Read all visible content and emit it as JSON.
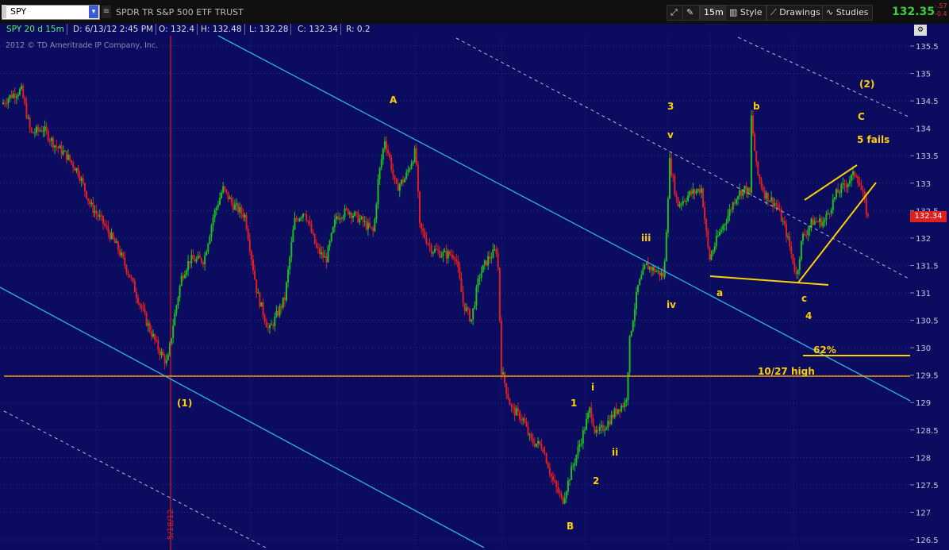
{
  "toolbar": {
    "symbol": "SPY",
    "description": "SPDR TR S&P 500 ETF TRUST",
    "interval": "15m",
    "style_label": "Style",
    "drawings_label": "Drawings",
    "studies_label": "Studies",
    "last_price": "132.35",
    "change_line1": "-.57",
    "change_line2": "-0.4"
  },
  "info_bar": {
    "ticker": "SPY 20 d 15m",
    "date": "D: 6/13/12 2:45 PM",
    "open": "O: 132.4",
    "high": "H: 132.48",
    "low": "L: 132.28",
    "close": "C: 132.34",
    "range": "R: 0.2"
  },
  "copyright": "2012 © TD Ameritrade IP Company, Inc.",
  "price_tag": "132.34",
  "vline_date": "5/18/12",
  "colors": {
    "background": "#0b0b5f",
    "up": "#1fbf1f",
    "down": "#e02020",
    "trend": "#2fb4e6",
    "annotation": "#ffd000"
  },
  "chart_data": {
    "type": "candlestick",
    "y_ticks": [
      135.5,
      135,
      134.5,
      134,
      133.5,
      133,
      132.5,
      132,
      131.5,
      131,
      130.5,
      130,
      129.5,
      129,
      128.5,
      128,
      127.5,
      127,
      126.5
    ],
    "ylim": [
      126.5,
      135.5
    ],
    "bars_count": 520,
    "price_path": [
      [
        0,
        134.4
      ],
      [
        15,
        134.6
      ],
      [
        28,
        134.7
      ],
      [
        40,
        133.9
      ],
      [
        55,
        134.0
      ],
      [
        70,
        133.7
      ],
      [
        85,
        133.5
      ],
      [
        100,
        133.2
      ],
      [
        115,
        132.6
      ],
      [
        130,
        132.3
      ],
      [
        150,
        131.8
      ],
      [
        165,
        131.3
      ],
      [
        185,
        130.5
      ],
      [
        200,
        130.0
      ],
      [
        212,
        129.7
      ],
      [
        220,
        130.5
      ],
      [
        230,
        131.3
      ],
      [
        240,
        131.6
      ],
      [
        258,
        131.6
      ],
      [
        270,
        132.4
      ],
      [
        282,
        132.9
      ],
      [
        295,
        132.6
      ],
      [
        310,
        132.4
      ],
      [
        325,
        131.0
      ],
      [
        340,
        130.3
      ],
      [
        360,
        130.9
      ],
      [
        372,
        132.3
      ],
      [
        385,
        132.5
      ],
      [
        400,
        131.8
      ],
      [
        412,
        131.6
      ],
      [
        425,
        132.4
      ],
      [
        440,
        132.5
      ],
      [
        458,
        132.3
      ],
      [
        472,
        132.1
      ],
      [
        478,
        133.1
      ],
      [
        486,
        133.8
      ],
      [
        493,
        133.4
      ],
      [
        500,
        132.9
      ],
      [
        512,
        133.1
      ],
      [
        525,
        133.6
      ],
      [
        530,
        132.2
      ],
      [
        545,
        131.8
      ],
      [
        560,
        131.7
      ],
      [
        575,
        131.7
      ],
      [
        585,
        130.8
      ],
      [
        595,
        130.5
      ],
      [
        605,
        131.3
      ],
      [
        615,
        131.6
      ],
      [
        628,
        131.8
      ],
      [
        633,
        129.6
      ],
      [
        645,
        128.9
      ],
      [
        660,
        128.7
      ],
      [
        670,
        128.3
      ],
      [
        685,
        128.2
      ],
      [
        697,
        127.6
      ],
      [
        710,
        127.2
      ],
      [
        722,
        127.8
      ],
      [
        733,
        128.3
      ],
      [
        745,
        128.9
      ],
      [
        752,
        128.4
      ],
      [
        765,
        128.6
      ],
      [
        780,
        128.9
      ],
      [
        790,
        129.0
      ],
      [
        795,
        130.2
      ],
      [
        805,
        131.1
      ],
      [
        815,
        131.5
      ],
      [
        828,
        131.4
      ],
      [
        838,
        131.3
      ],
      [
        842,
        132.5
      ],
      [
        845,
        133.4
      ],
      [
        855,
        132.6
      ],
      [
        870,
        132.8
      ],
      [
        885,
        132.9
      ],
      [
        895,
        131.6
      ],
      [
        905,
        132.0
      ],
      [
        918,
        132.4
      ],
      [
        930,
        132.8
      ],
      [
        940,
        132.9
      ],
      [
        946,
        132.8
      ],
      [
        948,
        134.2
      ],
      [
        955,
        133.2
      ],
      [
        965,
        132.8
      ],
      [
        980,
        132.6
      ],
      [
        992,
        132.1
      ],
      [
        1005,
        131.3
      ],
      [
        1012,
        132.0
      ],
      [
        1025,
        132.3
      ],
      [
        1040,
        132.3
      ],
      [
        1055,
        132.8
      ],
      [
        1068,
        133.0
      ],
      [
        1080,
        133.2
      ],
      [
        1090,
        132.7
      ],
      [
        1095,
        132.35
      ]
    ]
  },
  "annotations": {
    "wave_1": "(1)",
    "wave_2": "(2)",
    "A": "A",
    "B": "B",
    "C": "C",
    "three": "3",
    "v": "v",
    "iii": "iii",
    "iv": "iv",
    "b": "b",
    "a": "a",
    "c": "c",
    "four": "4",
    "one": "1",
    "two": "2",
    "i": "i",
    "ii": "ii",
    "fails": "5 fails",
    "fib": "62%",
    "high_label": "10/27 high"
  }
}
